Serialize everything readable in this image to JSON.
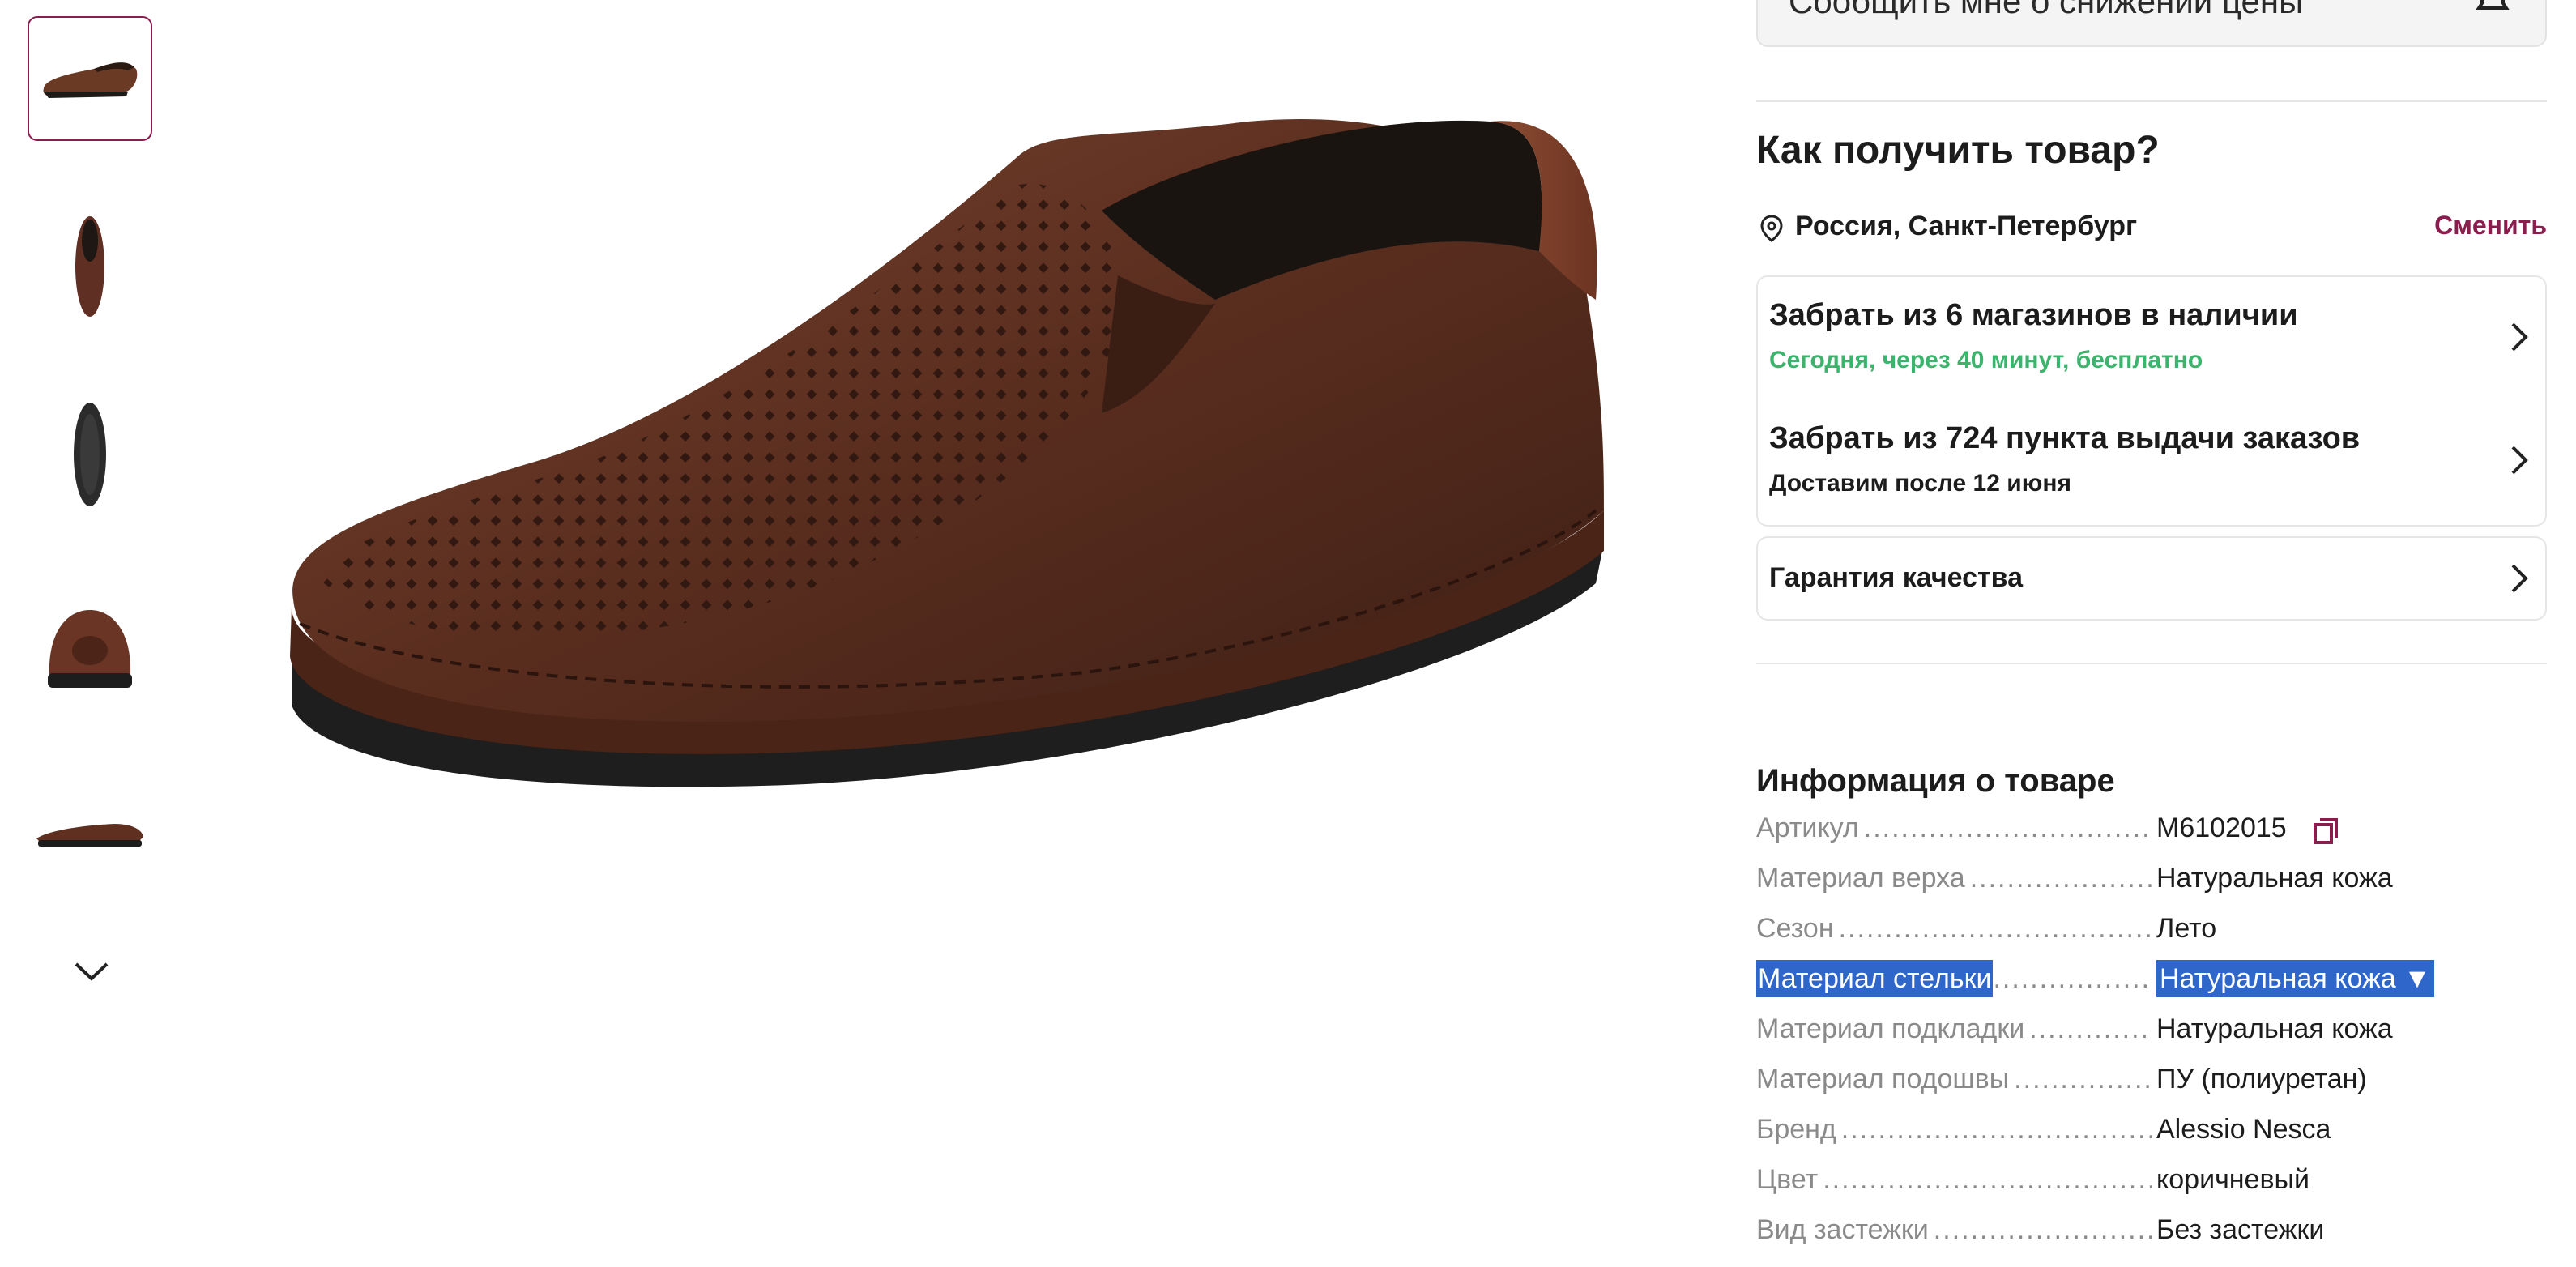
{
  "gallery": {
    "thumbnails": [
      {
        "name": "thumb-side-view",
        "active": true
      },
      {
        "name": "thumb-top-view",
        "active": false
      },
      {
        "name": "thumb-sole-view",
        "active": false
      },
      {
        "name": "thumb-back-view",
        "active": false
      },
      {
        "name": "thumb-profile-view",
        "active": false
      }
    ],
    "scroll_icon": "chevron-down-icon"
  },
  "notify": {
    "label": "Сообщить мне о снижении цены",
    "icon": "bell-icon"
  },
  "delivery": {
    "heading": "Как получить товар?",
    "location": "Россия, Санкт-Петербург",
    "change_label": "Сменить",
    "options": [
      {
        "title": "Забрать из 6 магазинов в наличии",
        "subtitle": "Сегодня, через 40 минут, бесплатно"
      },
      {
        "title": "Забрать из 724 пункта выдачи заказов",
        "subtitle": "Доставим после 12 июня"
      }
    ],
    "guarantee": "Гарантия качества"
  },
  "info": {
    "heading": "Информация о товаре",
    "specs": [
      {
        "key": "Артикул",
        "value": "M6102015"
      },
      {
        "key": "Материал верха",
        "value": "Натуральная кожа"
      },
      {
        "key": "Сезон",
        "value": "Лето"
      },
      {
        "key": "Материал стельки",
        "value": "Натуральная кожа ▼"
      },
      {
        "key": "Материал подкладки",
        "value": "Натуральная кожа"
      },
      {
        "key": "Материал подошвы",
        "value": "ПУ (полиуретан)"
      },
      {
        "key": "Бренд",
        "value": "Alessio Nesca"
      },
      {
        "key": "Цвет",
        "value": "коричневый"
      },
      {
        "key": "Вид застежки",
        "value": "Без застежки"
      }
    ]
  },
  "colors": {
    "accent": "#8a1c4e",
    "green": "#3db46d",
    "selection": "#2e66c9"
  }
}
